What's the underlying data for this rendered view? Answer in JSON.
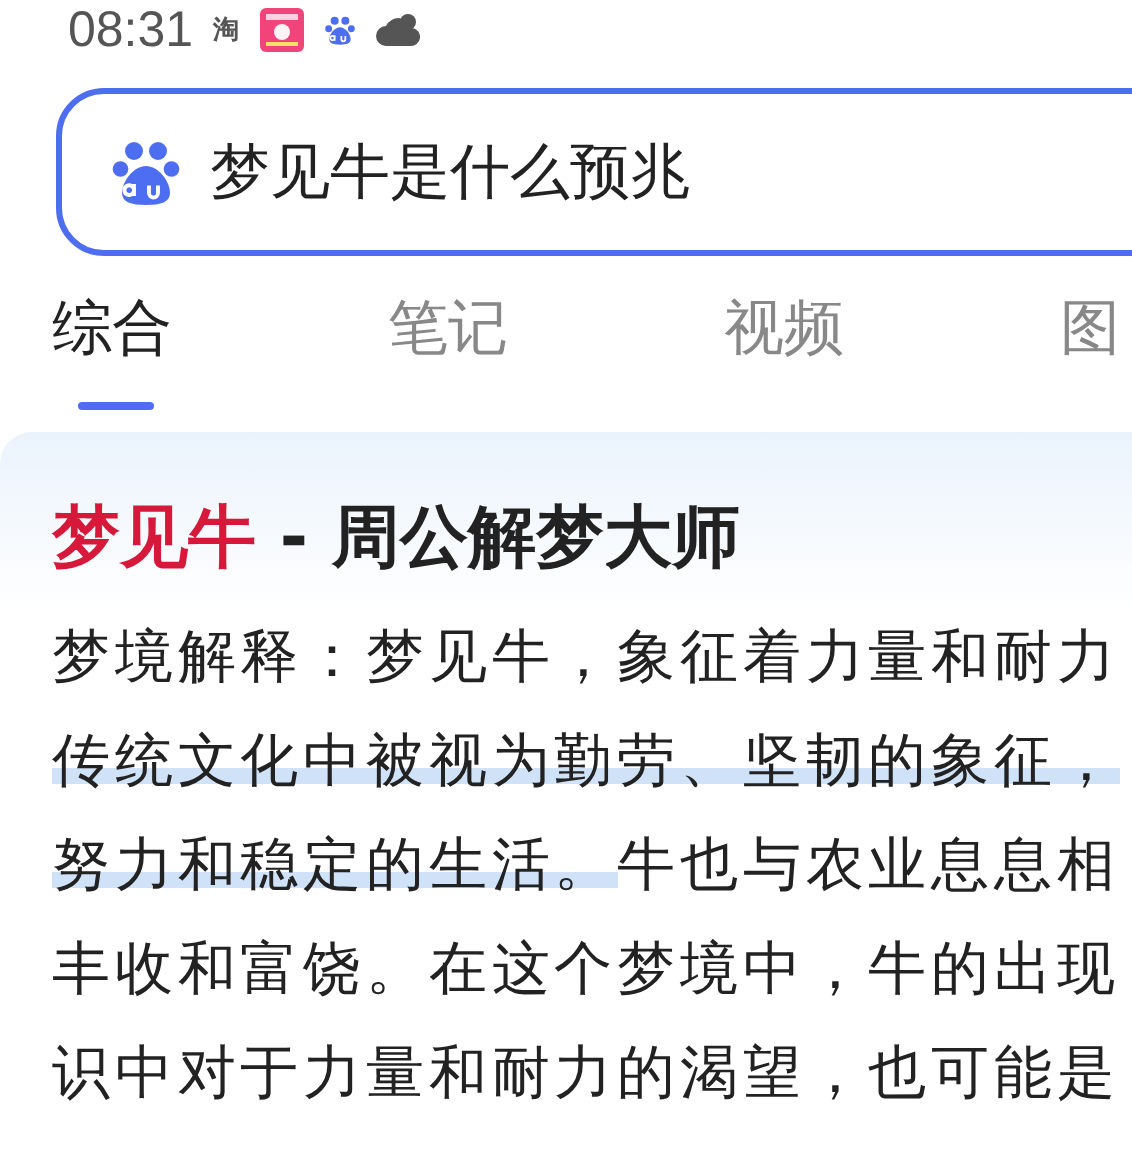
{
  "status_bar": {
    "time": "08:31",
    "app_glyph": "淘"
  },
  "search": {
    "value": "梦见牛是什么预兆"
  },
  "tabs": [
    {
      "label": "综合",
      "selected": true
    },
    {
      "label": "笔记",
      "selected": false
    },
    {
      "label": "视频",
      "selected": false
    },
    {
      "label": "图",
      "selected": false
    }
  ],
  "result": {
    "title": {
      "keyword": "梦见牛",
      "rest": " - 周公解梦大师"
    },
    "lines": [
      [
        {
          "text": "梦境解释：梦见牛，象征着力量和耐力",
          "highlighted": false
        }
      ],
      [
        {
          "text": "传统文化中被视为勤劳、坚韧的象征，",
          "highlighted": true
        }
      ],
      [
        {
          "text": "努力和稳定的生活。",
          "highlighted": true
        },
        {
          "text": "牛也与农业息息相",
          "highlighted": false
        }
      ],
      [
        {
          "text": "丰收和富饶。在这个梦境中，牛的出现",
          "highlighted": false
        }
      ],
      [
        {
          "text": "识中对于力量和耐力的渴望，也可能是",
          "highlighted": false
        }
      ]
    ]
  }
}
